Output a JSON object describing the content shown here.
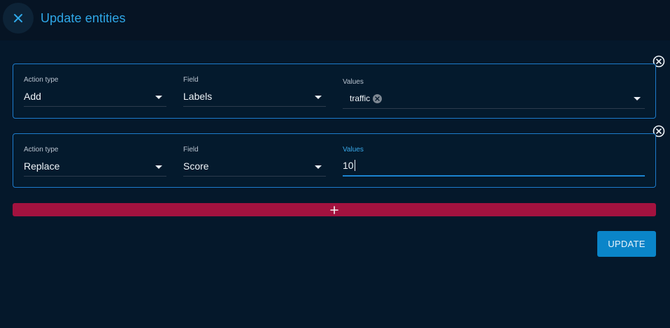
{
  "header": {
    "title": "Update entities",
    "close_icon": "close-icon"
  },
  "operations": [
    {
      "action_type_label": "Action type",
      "action_type_value": "Add",
      "field_label": "Field",
      "field_value": "Labels",
      "values_label": "Values",
      "values_chips": [
        "traffic"
      ]
    },
    {
      "action_type_label": "Action type",
      "action_type_value": "Replace",
      "field_label": "Field",
      "field_value": "Score",
      "values_label": "Values",
      "values_input": "10"
    }
  ],
  "add_button": {
    "icon": "plus-icon"
  },
  "update_button": {
    "label": "UPDATE"
  },
  "colors": {
    "background": "#05182b",
    "header": "#061424",
    "accent": "#2fa8e8",
    "card_border": "#1d7ccd",
    "add_bar": "#a3123f",
    "update_button": "#0a85c9"
  }
}
